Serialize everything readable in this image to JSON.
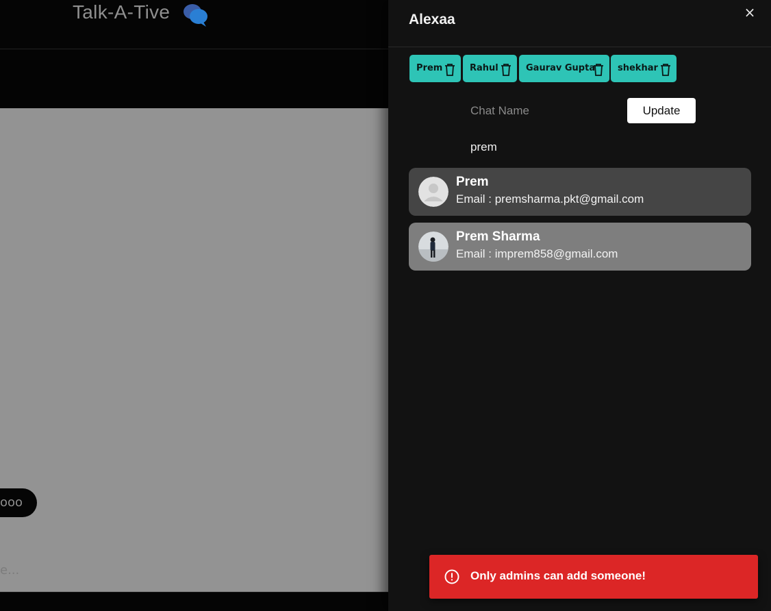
{
  "app": {
    "brand": "Talk-A-Tive",
    "message_bubble_text": "ooo",
    "message_input_hint": "e..."
  },
  "drawer": {
    "title": "Alexaa",
    "close_label": "×",
    "members": [
      {
        "name": "Prem"
      },
      {
        "name": "Rahul"
      },
      {
        "name": "Gaurav Gupta"
      },
      {
        "name": "shekhar"
      }
    ],
    "chat_name_placeholder": "Chat Name",
    "update_label": "Update",
    "search_value": "prem",
    "results": [
      {
        "name": "Prem",
        "email_label": "Email :",
        "email": "premsharma.pkt@gmail.com"
      },
      {
        "name": "Prem Sharma",
        "email_label": "Email :",
        "email": "imprem858@gmail.com"
      }
    ]
  },
  "toast": {
    "message": "Only admins can add someone!",
    "status": "error",
    "color": "#dc2626"
  },
  "colors": {
    "tag": "#2ec4b6",
    "drawer_bg": "#121212"
  }
}
